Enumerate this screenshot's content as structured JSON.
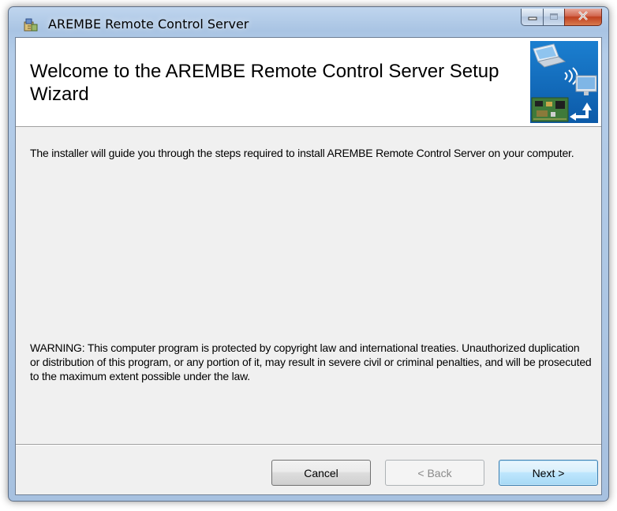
{
  "window": {
    "title": "AREMBE Remote Control Server",
    "app_icon": "installer-icon",
    "caption_buttons": [
      "minimize-icon",
      "maximize-icon",
      "close-icon"
    ]
  },
  "banner": {
    "title": "Welcome to the AREMBE Remote Control Server Setup Wizard",
    "image": "remote-control-banner-image"
  },
  "body": {
    "intro": "The installer will guide you through the steps required to install AREMBE Remote Control Server on your computer.",
    "warning": "WARNING: This computer program is protected by copyright law and international treaties. Unauthorized duplication or distribution of this program, or any portion of it, may result in severe civil or criminal penalties, and will be prosecuted to the maximum extent possible under the law."
  },
  "buttons": {
    "cancel": "Cancel",
    "back": "< Back",
    "next": "Next >"
  },
  "colors": {
    "title_bar": "#b4cde9",
    "client_background": "#f0f0f0",
    "close_button": "#c0401f",
    "default_button_border": "#3c7fb1"
  }
}
